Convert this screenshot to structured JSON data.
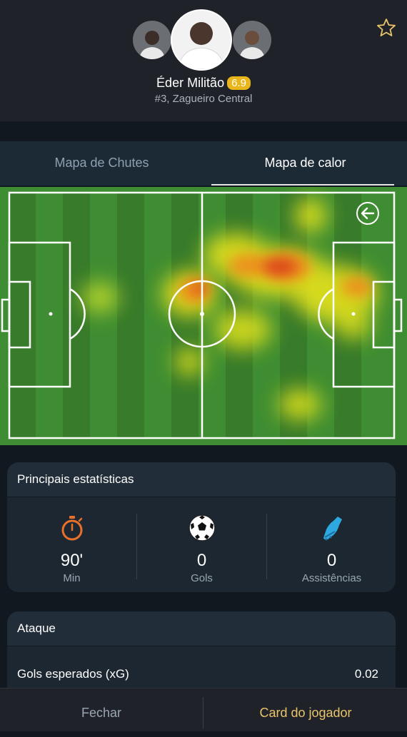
{
  "player": {
    "name": "Éder Militão",
    "rating": "6.9",
    "subtitle": "#3, Zagueiro Central"
  },
  "tabs": [
    {
      "label": "Mapa de Chutes",
      "active": false
    },
    {
      "label": "Mapa de calor",
      "active": true
    }
  ],
  "heatmap": {
    "pitch_color": "#3f8d32"
  },
  "main_stats": {
    "title": "Principais estatísticas",
    "items": [
      {
        "icon": "stopwatch-icon",
        "value": "90'",
        "label": "Min"
      },
      {
        "icon": "soccer-ball-icon",
        "value": "0",
        "label": "Gols"
      },
      {
        "icon": "soccer-boot-icon",
        "value": "0",
        "label": "Assistências"
      }
    ]
  },
  "attack": {
    "title": "Ataque",
    "rows": [
      {
        "label": "Gols esperados (xG)",
        "value": "0.02"
      }
    ]
  },
  "footer": {
    "close_label": "Fechar",
    "card_label": "Card do jogador"
  },
  "colors": {
    "rating_badge": "#e8b51a",
    "stopwatch": "#e8702a",
    "boot": "#2ea8e0",
    "card_button": "#e9c46a"
  }
}
